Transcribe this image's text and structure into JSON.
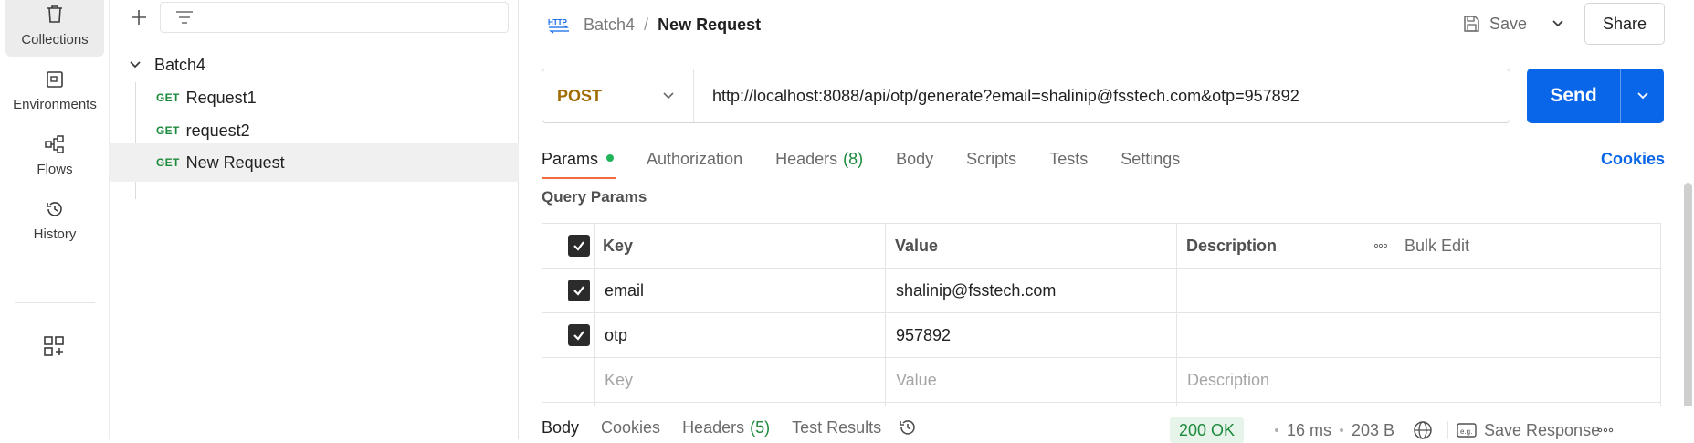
{
  "rail": {
    "items": [
      {
        "label": "Collections",
        "icon": "trash-bin-icon"
      },
      {
        "label": "Environments",
        "icon": "environment-icon"
      },
      {
        "label": "Flows",
        "icon": "flows-icon"
      },
      {
        "label": "History",
        "icon": "history-icon"
      }
    ],
    "extra_icon": "add-widget-icon"
  },
  "sidebar": {
    "collection": "Batch4",
    "requests": [
      {
        "method": "GET",
        "name": "Request1"
      },
      {
        "method": "GET",
        "name": "request2"
      },
      {
        "method": "GET",
        "name": "New Request"
      }
    ]
  },
  "header": {
    "protocol_icon_text": "HTTP",
    "breadcrumb_parent": "Batch4",
    "breadcrumb_sep": "/",
    "breadcrumb_current": "New Request",
    "save_label": "Save",
    "share_label": "Share"
  },
  "request": {
    "method": "POST",
    "url": "http://localhost:8088/api/otp/generate?email=shalinip@fsstech.com&otp=957892",
    "send_label": "Send"
  },
  "tabs": [
    {
      "label": "Params",
      "count": ""
    },
    {
      "label": "Authorization",
      "count": ""
    },
    {
      "label": "Headers",
      "count": "(8)"
    },
    {
      "label": "Body",
      "count": ""
    },
    {
      "label": "Scripts",
      "count": ""
    },
    {
      "label": "Tests",
      "count": ""
    },
    {
      "label": "Settings",
      "count": ""
    }
  ],
  "cookies_link": "Cookies",
  "query_params": {
    "title": "Query Params",
    "headers": {
      "key": "Key",
      "value": "Value",
      "description": "Description",
      "bulk_edit": "Bulk Edit"
    },
    "rows": [
      {
        "key": "email",
        "value": "shalinip@fsstech.com",
        "description": "",
        "checked": true
      },
      {
        "key": "otp",
        "value": "957892",
        "description": "",
        "checked": true
      }
    ],
    "placeholders": {
      "key": "Key",
      "value": "Value",
      "description": "Description"
    }
  },
  "response": {
    "tabs": [
      {
        "label": "Body",
        "count": ""
      },
      {
        "label": "Cookies",
        "count": ""
      },
      {
        "label": "Headers",
        "count": "(5)"
      },
      {
        "label": "Test Results",
        "count": ""
      }
    ],
    "status": "200 OK",
    "time": "16 ms",
    "size": "203 B",
    "save_response": "Save Response",
    "status_color": "#1c8a3c"
  },
  "colors": {
    "accent": "#0a66e8",
    "method_post": "#a06b00",
    "method_get": "#1c8a3c",
    "active_tab_underline": "#f26b3a"
  }
}
